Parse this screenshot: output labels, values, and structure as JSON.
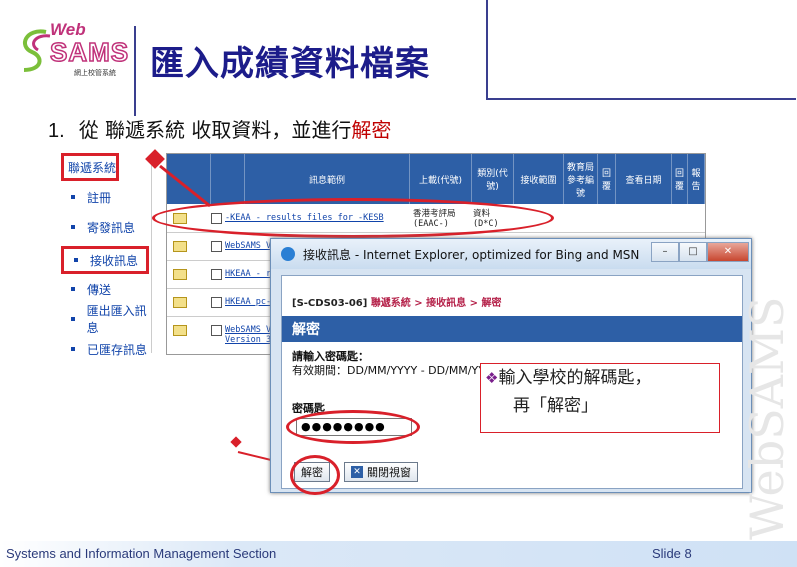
{
  "logo": {
    "web": "Web",
    "sams": "SAMS",
    "subtitle": "網上校管系統"
  },
  "title": "匯入成績資料檔案",
  "step": {
    "number": "1.",
    "text": "從 聯遞系統 收取資料，並進行",
    "highlight": "解密"
  },
  "sidebar": {
    "header": "聯遞系統",
    "items": [
      "註冊",
      "寄發訊息",
      "接收訊息",
      "傳送",
      "匯出匯入訊息",
      "已匯存訊息"
    ]
  },
  "table": {
    "headers": [
      "訊息範例",
      "上載(代號)",
      "類別(代號)",
      "接收範圍",
      "教育局參考編號",
      "回覆",
      "查看日期",
      "回覆",
      "報告"
    ],
    "rows": [
      {
        "name": "-KEAA - results files for -KESB",
        "dept": "香港考評局",
        "code": "(EAAC-)",
        "type": "資料",
        "typecode": "(D*C)"
      },
      {
        "name": "WebSAMS Ver",
        "dept": "",
        "code": "",
        "type": "",
        "typecode": ""
      },
      {
        "name": "HKEAA - res",
        "dept": "",
        "code": "",
        "type": "",
        "typecode": ""
      },
      {
        "name": "HKEAA pc-ca",
        "dept": "",
        "code": "",
        "type": "",
        "typecode": ""
      },
      {
        "name": "WebSAMS Ver",
        "dept": "",
        "code": "",
        "type": "",
        "typecode": ""
      },
      {
        "name": "Version 3.0",
        "dept": "",
        "code": "",
        "type": "",
        "typecode": ""
      }
    ]
  },
  "dialog": {
    "window_title": "接收訊息 - Internet Explorer, optimized for Bing and MSN",
    "breadcrumb_code": "[S-CDS03-06]",
    "breadcrumb": "聯遞系統 > 接收訊息 > 解密",
    "section": "解密",
    "prompt": "請輸入密碼匙：",
    "period": "有效期間：DD/MM/YYYY - DD/MM/YYYY",
    "password_label": "密碼匙",
    "password_value": "●●●●●●●●",
    "decrypt_button": "解密",
    "close_button": "關閉視窗",
    "minimize": "–",
    "maximize": "□",
    "close": "✕"
  },
  "callout": {
    "mark": "❖",
    "line1": "輸入學校的解碼匙，",
    "line2": "再「解密」"
  },
  "footer": {
    "left": "Systems and Information Management Section",
    "right": "Slide 8"
  },
  "watermark": "WebSAMS",
  "colors": {
    "accent_red": "#d9202a",
    "header_blue": "#2d5fa6",
    "title_navy": "#1c1c8a"
  }
}
